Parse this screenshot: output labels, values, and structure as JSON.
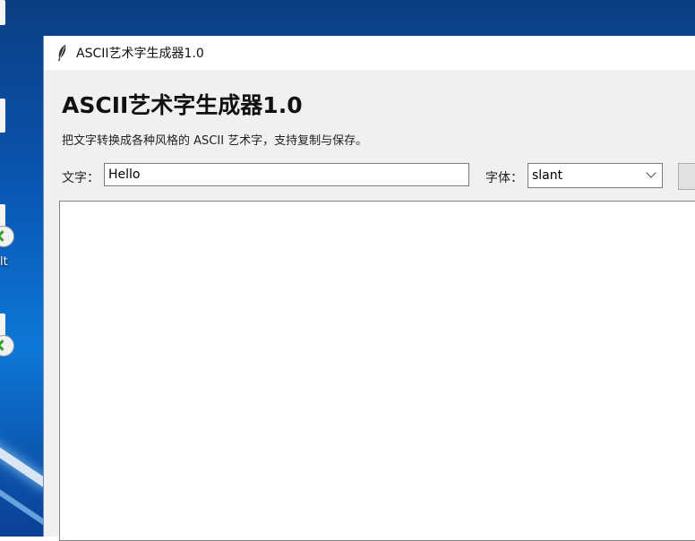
{
  "desktop": {
    "icon_label_partial": "lt"
  },
  "window": {
    "title": "ASCII艺术字生成器1.0"
  },
  "app": {
    "heading": "ASCII艺术字生成器1.0",
    "subtitle": "把文字转换成各种风格的 ASCII 艺术字，支持复制与保存。",
    "text_label": "文字：",
    "text_value": "Hello",
    "font_label": "字体：",
    "font_value": "slant",
    "output_text": ""
  }
}
